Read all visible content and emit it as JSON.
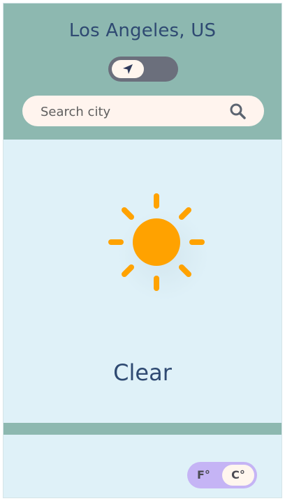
{
  "header": {
    "city": "Los Angeles, US",
    "location_toggle": {
      "icon": "navigation-arrow-icon",
      "active": true
    },
    "search": {
      "placeholder": "Search city",
      "value": "",
      "icon": "search-icon"
    }
  },
  "weather": {
    "icon": "sun-icon",
    "condition": "Clear"
  },
  "units": {
    "f_label": "F°",
    "c_label": "C°",
    "selected": "C°"
  },
  "colors": {
    "header_bg": "#8db8b0",
    "body_bg": "#dff1f8",
    "text": "#2f4a72",
    "sun": "#ffa200",
    "unit_toggle_bg": "#c5b4f5",
    "location_toggle_bg": "#6b6f7c"
  }
}
